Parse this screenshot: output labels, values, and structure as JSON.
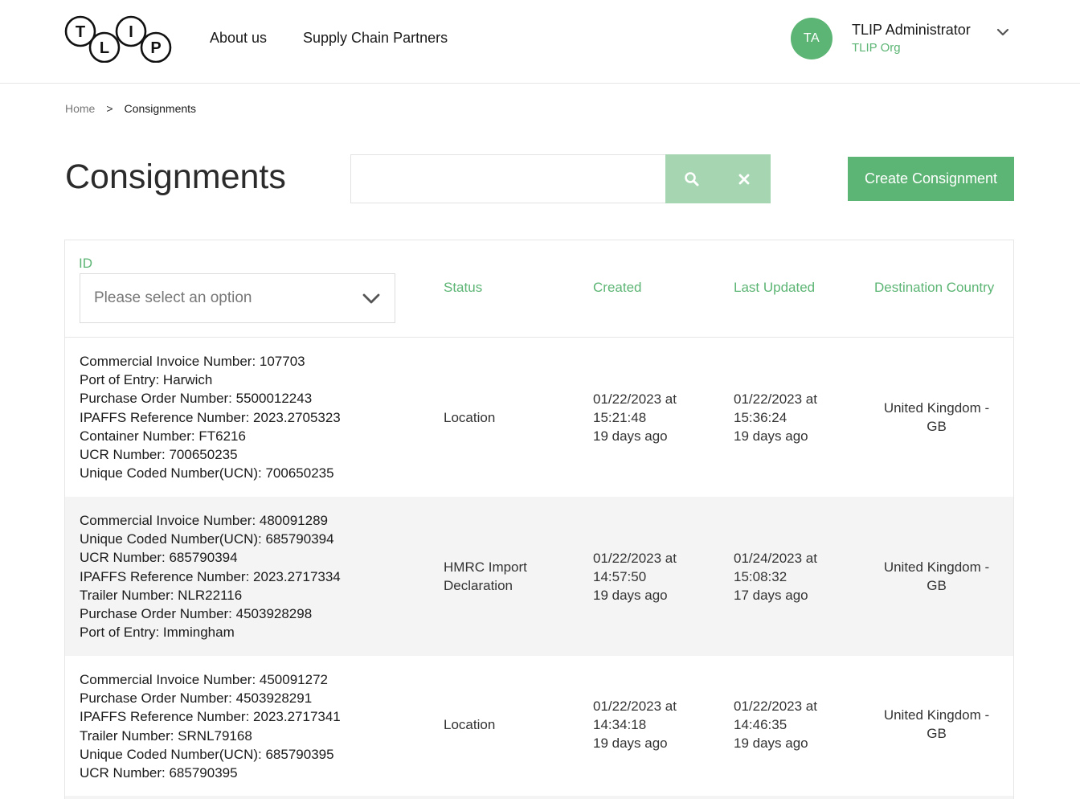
{
  "header": {
    "logo_letters": [
      "T",
      "L",
      "I",
      "P"
    ],
    "nav": {
      "about": "About us",
      "partners": "Supply Chain Partners"
    },
    "user": {
      "initials": "TA",
      "name": "TLIP Administrator",
      "org": "TLIP Org"
    }
  },
  "breadcrumb": {
    "home": "Home",
    "separator": ">",
    "current": "Consignments"
  },
  "page": {
    "title": "Consignments",
    "search_value": "",
    "create_button": "Create Consignment"
  },
  "table": {
    "id_label": "ID",
    "id_select_placeholder": "Please select an option",
    "columns": {
      "status": "Status",
      "created": "Created",
      "updated": "Last Updated",
      "country": "Destination Country"
    },
    "rows": [
      {
        "details": [
          "Commercial Invoice Number: 107703",
          "Port of Entry: Harwich",
          "Purchase Order Number: 5500012243",
          "IPAFFS Reference Number: 2023.2705323",
          "Container Number: FT6216",
          "UCR Number: 700650235",
          "Unique Coded Number(UCN): 700650235"
        ],
        "status": "Location",
        "created": [
          "01/22/2023 at",
          "15:21:48",
          "19 days ago"
        ],
        "updated": [
          "01/22/2023 at",
          "15:36:24",
          "19 days ago"
        ],
        "country": [
          "United Kingdom -",
          "GB"
        ]
      },
      {
        "details": [
          "Commercial Invoice Number: 480091289",
          "Unique Coded Number(UCN): 685790394",
          "UCR Number: 685790394",
          "IPAFFS Reference Number: 2023.2717334",
          "Trailer Number: NLR22116",
          "Purchase Order Number: 4503928298",
          "Port of Entry: Immingham"
        ],
        "status": "HMRC Import Declaration",
        "created": [
          "01/22/2023 at",
          "14:57:50",
          "19 days ago"
        ],
        "updated": [
          "01/24/2023 at",
          "15:08:32",
          "17 days ago"
        ],
        "country": [
          "United Kingdom -",
          "GB"
        ]
      },
      {
        "details": [
          "Commercial Invoice Number: 450091272",
          "Purchase Order Number: 4503928291",
          "IPAFFS Reference Number: 2023.2717341",
          "Trailer Number: SRNL79168",
          "Unique Coded Number(UCN): 685790395",
          "UCR Number: 685790395"
        ],
        "status": "Location",
        "created": [
          "01/22/2023 at",
          "14:34:18",
          "19 days ago"
        ],
        "updated": [
          "01/22/2023 at",
          "14:46:35",
          "19 days ago"
        ],
        "country": [
          "United Kingdom -",
          "GB"
        ]
      }
    ]
  },
  "colors": {
    "brand_green": "#5cb574",
    "search_button_bg": "#a6d6b1",
    "row_alt_bg": "#f4f4f4"
  },
  "icons": {
    "search": "search-icon",
    "clear": "close-icon",
    "user_menu": "chevron-down-icon",
    "select": "chevron-down-icon"
  }
}
